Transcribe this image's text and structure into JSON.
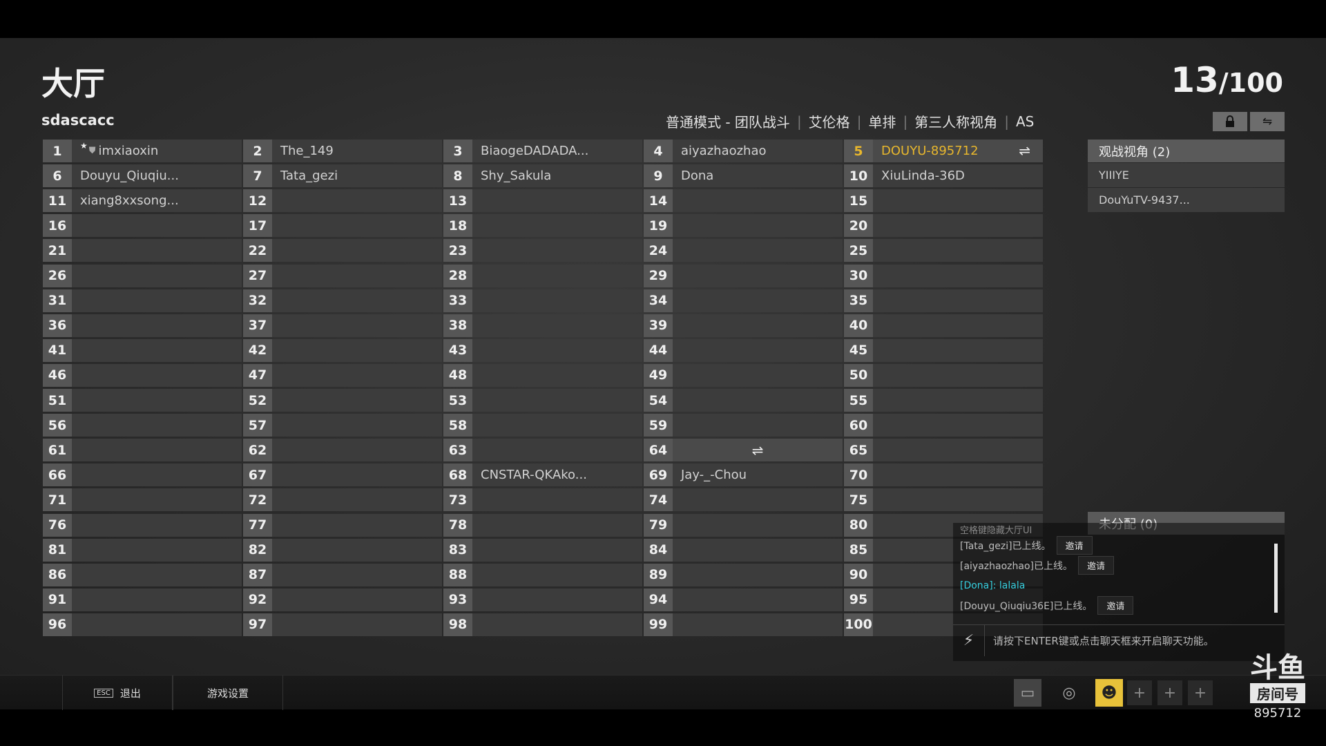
{
  "header": {
    "title": "大厅",
    "count_current": "13",
    "count_total": "/100",
    "username": "sdascacc",
    "mode_parts": [
      "普通模式 - 团队战斗",
      "艾伦格",
      "单排",
      "第三人称视角",
      "AS"
    ]
  },
  "icons": {
    "lock": "lock-icon",
    "swap": "swap-icon"
  },
  "slots": [
    {
      "n": "1",
      "name": "imxiaoxin",
      "host": true
    },
    {
      "n": "2",
      "name": "The_149"
    },
    {
      "n": "3",
      "name": "BiaogeDADADA..."
    },
    {
      "n": "4",
      "name": "aiyazhaozhao"
    },
    {
      "n": "5",
      "name": "DOUYU-895712",
      "self": true
    },
    {
      "n": "6",
      "name": "Douyu_Qiuqiu..."
    },
    {
      "n": "7",
      "name": "Tata_gezi"
    },
    {
      "n": "8",
      "name": "Shy_Sakula"
    },
    {
      "n": "9",
      "name": "Dona"
    },
    {
      "n": "10",
      "name": "XiuLinda-36D"
    },
    {
      "n": "11",
      "name": "xiang8xxsong..."
    },
    {
      "n": "12",
      "name": ""
    },
    {
      "n": "13",
      "name": ""
    },
    {
      "n": "14",
      "name": ""
    },
    {
      "n": "15",
      "name": ""
    },
    {
      "n": "16",
      "name": ""
    },
    {
      "n": "17",
      "name": ""
    },
    {
      "n": "18",
      "name": ""
    },
    {
      "n": "19",
      "name": ""
    },
    {
      "n": "20",
      "name": ""
    },
    {
      "n": "21",
      "name": ""
    },
    {
      "n": "22",
      "name": ""
    },
    {
      "n": "23",
      "name": ""
    },
    {
      "n": "24",
      "name": ""
    },
    {
      "n": "25",
      "name": ""
    },
    {
      "n": "26",
      "name": ""
    },
    {
      "n": "27",
      "name": ""
    },
    {
      "n": "28",
      "name": ""
    },
    {
      "n": "29",
      "name": ""
    },
    {
      "n": "30",
      "name": ""
    },
    {
      "n": "31",
      "name": ""
    },
    {
      "n": "32",
      "name": ""
    },
    {
      "n": "33",
      "name": ""
    },
    {
      "n": "34",
      "name": ""
    },
    {
      "n": "35",
      "name": ""
    },
    {
      "n": "36",
      "name": ""
    },
    {
      "n": "37",
      "name": ""
    },
    {
      "n": "38",
      "name": ""
    },
    {
      "n": "39",
      "name": ""
    },
    {
      "n": "40",
      "name": ""
    },
    {
      "n": "41",
      "name": ""
    },
    {
      "n": "42",
      "name": ""
    },
    {
      "n": "43",
      "name": ""
    },
    {
      "n": "44",
      "name": ""
    },
    {
      "n": "45",
      "name": ""
    },
    {
      "n": "46",
      "name": ""
    },
    {
      "n": "47",
      "name": ""
    },
    {
      "n": "48",
      "name": ""
    },
    {
      "n": "49",
      "name": ""
    },
    {
      "n": "50",
      "name": ""
    },
    {
      "n": "51",
      "name": ""
    },
    {
      "n": "52",
      "name": ""
    },
    {
      "n": "53",
      "name": ""
    },
    {
      "n": "54",
      "name": ""
    },
    {
      "n": "55",
      "name": ""
    },
    {
      "n": "56",
      "name": ""
    },
    {
      "n": "57",
      "name": ""
    },
    {
      "n": "58",
      "name": ""
    },
    {
      "n": "59",
      "name": ""
    },
    {
      "n": "60",
      "name": ""
    },
    {
      "n": "61",
      "name": ""
    },
    {
      "n": "62",
      "name": ""
    },
    {
      "n": "63",
      "name": ""
    },
    {
      "n": "64",
      "name": "",
      "swap": true
    },
    {
      "n": "65",
      "name": ""
    },
    {
      "n": "66",
      "name": ""
    },
    {
      "n": "67",
      "name": ""
    },
    {
      "n": "68",
      "name": "CNSTAR-QKAko..."
    },
    {
      "n": "69",
      "name": "Jay-_-Chou"
    },
    {
      "n": "70",
      "name": ""
    },
    {
      "n": "71",
      "name": ""
    },
    {
      "n": "72",
      "name": ""
    },
    {
      "n": "73",
      "name": ""
    },
    {
      "n": "74",
      "name": ""
    },
    {
      "n": "75",
      "name": ""
    },
    {
      "n": "76",
      "name": ""
    },
    {
      "n": "77",
      "name": ""
    },
    {
      "n": "78",
      "name": ""
    },
    {
      "n": "79",
      "name": ""
    },
    {
      "n": "80",
      "name": ""
    },
    {
      "n": "81",
      "name": ""
    },
    {
      "n": "82",
      "name": ""
    },
    {
      "n": "83",
      "name": ""
    },
    {
      "n": "84",
      "name": ""
    },
    {
      "n": "85",
      "name": ""
    },
    {
      "n": "86",
      "name": ""
    },
    {
      "n": "87",
      "name": ""
    },
    {
      "n": "88",
      "name": ""
    },
    {
      "n": "89",
      "name": ""
    },
    {
      "n": "90",
      "name": ""
    },
    {
      "n": "91",
      "name": ""
    },
    {
      "n": "92",
      "name": ""
    },
    {
      "n": "93",
      "name": ""
    },
    {
      "n": "94",
      "name": ""
    },
    {
      "n": "95",
      "name": ""
    },
    {
      "n": "96",
      "name": ""
    },
    {
      "n": "97",
      "name": ""
    },
    {
      "n": "98",
      "name": ""
    },
    {
      "n": "99",
      "name": ""
    },
    {
      "n": "100",
      "name": ""
    }
  ],
  "spectators": {
    "header": "观战视角 (2)",
    "items": [
      "YIIIYE",
      "DouYuTV-9437..."
    ]
  },
  "unassigned": {
    "header": "未分配 (0)"
  },
  "chat": {
    "faded_line": "空格键隐藏大厅UI",
    "lines": [
      {
        "text": "[Tata_gezi]已上线。",
        "invite": "邀请"
      },
      {
        "text": "[aiyazhaozhao]已上线。",
        "invite": "邀请"
      },
      {
        "text": "[Dona]: lalala",
        "cyan": true
      },
      {
        "text": "[Douyu_Qiuqiu36E]已上线。",
        "invite": "邀请"
      }
    ],
    "input_placeholder": "请按下ENTER键或点击聊天框来开启聊天功能。"
  },
  "bottom": {
    "esc_key": "ESC",
    "exit_label": "退出",
    "settings_label": "游戏设置"
  },
  "watermark": {
    "logo": "斗鱼",
    "sub": "房间号",
    "room_id": "895712"
  },
  "colors": {
    "self_highlight": "#e8b72d",
    "chat_cyan": "#36d0e0"
  }
}
